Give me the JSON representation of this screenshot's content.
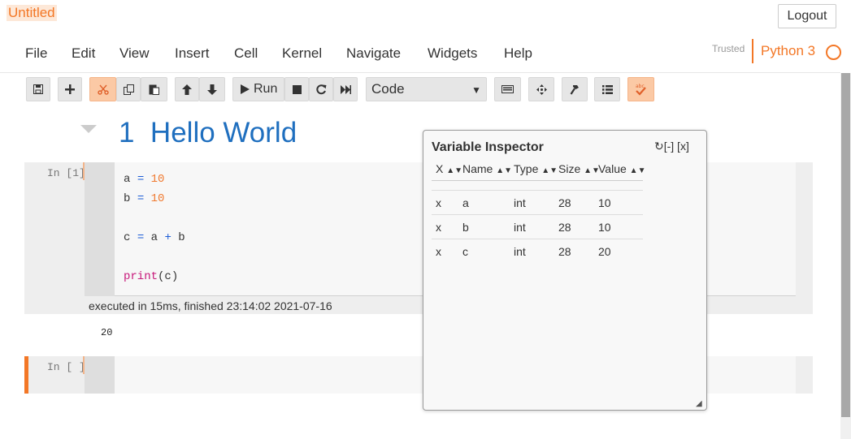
{
  "header": {
    "title": "Untitled",
    "logout_label": "Logout",
    "trusted_label": "Trusted",
    "kernel_name": "Python 3"
  },
  "menu": [
    "File",
    "Edit",
    "View",
    "Insert",
    "Cell",
    "Kernel",
    "Navigate",
    "Widgets",
    "Help"
  ],
  "toolbar": {
    "run_label": "Run",
    "cell_type": "Code"
  },
  "heading": {
    "number": "1",
    "text": "Hello World"
  },
  "cells": [
    {
      "prompt": "In [1]:",
      "exec_info": "executed in 15ms, finished 23:14:02 2021-07-16",
      "output": "20"
    },
    {
      "prompt": "In [ ]:"
    }
  ],
  "variable_inspector": {
    "title": "Variable Inspector",
    "controls": "↻[-] [x]",
    "columns": [
      "X",
      "Name",
      "Type",
      "Size",
      "Value"
    ],
    "rows": [
      {
        "x": "x",
        "name": "a",
        "type": "int",
        "size": "28",
        "value": "10"
      },
      {
        "x": "x",
        "name": "b",
        "type": "int",
        "size": "28",
        "value": "10"
      },
      {
        "x": "x",
        "name": "c",
        "type": "int",
        "size": "28",
        "value": "20"
      }
    ]
  },
  "colors": {
    "accent": "#f37726",
    "heading": "#1f6fbf"
  }
}
